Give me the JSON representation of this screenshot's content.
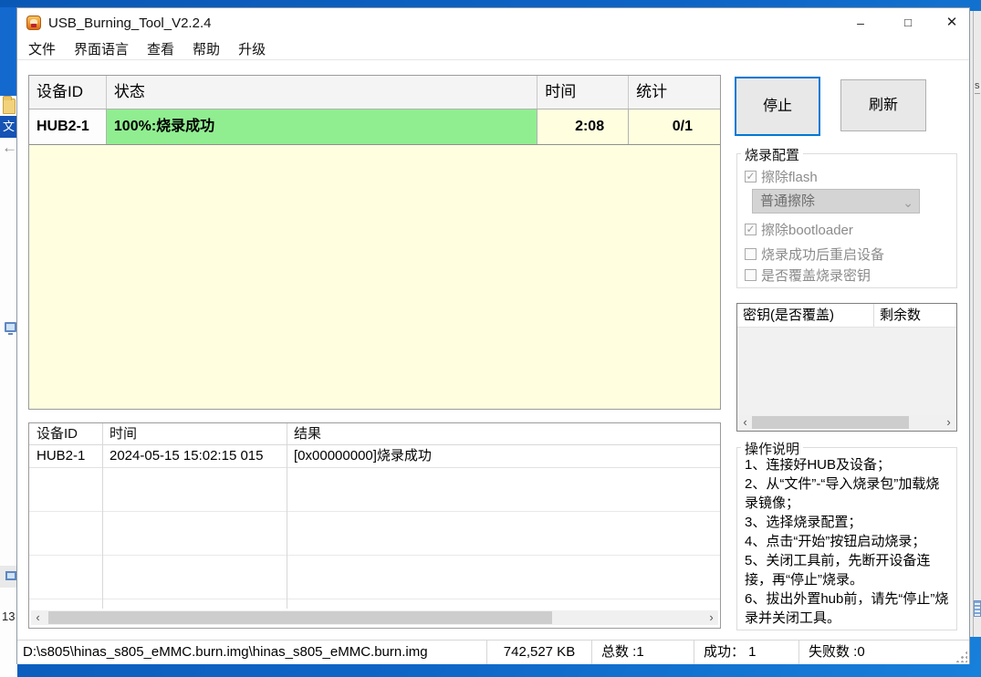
{
  "window": {
    "title": "USB_Burning_Tool_V2.2.4"
  },
  "window_controls": {
    "minimize": "–",
    "maximize": "□",
    "close": "✕"
  },
  "menu": {
    "items": [
      "文件",
      "界面语言",
      "查看",
      "帮助",
      "升级"
    ]
  },
  "device_table": {
    "columns": [
      "设备ID",
      "状态",
      "时间",
      "统计"
    ],
    "row": {
      "device_id": "HUB2-1",
      "status": "100%:烧录成功",
      "time": "2:08",
      "stat": "0/1"
    }
  },
  "buttons": {
    "stop": "停止",
    "refresh": "刷新"
  },
  "burn_config": {
    "title": "烧录配置",
    "erase_flash": {
      "label": "擦除flash",
      "checked": true
    },
    "erase_mode_selected": "普通擦除",
    "erase_bootloader": {
      "label": "擦除bootloader",
      "checked": true
    },
    "reboot_after_success": {
      "label": "烧录成功后重启设备",
      "checked": false
    },
    "overwrite_burn_key": {
      "label": "是否覆盖烧录密钥",
      "checked": false
    }
  },
  "key_table": {
    "columns": [
      "密钥(是否覆盖)",
      "剩余数"
    ]
  },
  "operation_help": {
    "title": "操作说明",
    "lines": [
      "1、连接好HUB及设备；",
      "2、从“文件”-“导入烧录包”加载烧录镜像；",
      "3、选择烧录配置；",
      "4、点击“开始”按钮启动烧录；",
      "5、关闭工具前，先断开设备连接，再“停止”烧录。",
      "6、拔出外置hub前，请先“停止”烧录并关闭工具。"
    ]
  },
  "log_table": {
    "columns": [
      "设备ID",
      "时间",
      "结果"
    ],
    "row": {
      "device_id": "HUB2-1",
      "time": "2024-05-15 15:02:15 015",
      "result": "[0x00000000]烧录成功"
    }
  },
  "status_bar": {
    "path": "D:\\s805\\hinas_s805_eMMC.burn.img\\hinas_s805_eMMC.burn.img",
    "size": "742,527 KB",
    "total": "总数 :1",
    "success": "成功： 1",
    "failed": "失败数 :0"
  },
  "background": {
    "left_badge": "13",
    "left_doc_glyph": "文",
    "right_fragment": "s"
  },
  "icons": {
    "check": "✓",
    "scroll_left": "‹",
    "scroll_right": "›",
    "combo_chevron": "⌄",
    "back_arrow": "←"
  },
  "colors": {
    "accent": "#0078D7",
    "success_green": "#90EE90",
    "table_bg": "#FFFFE0",
    "desktop_blue": "#0E65C6"
  }
}
